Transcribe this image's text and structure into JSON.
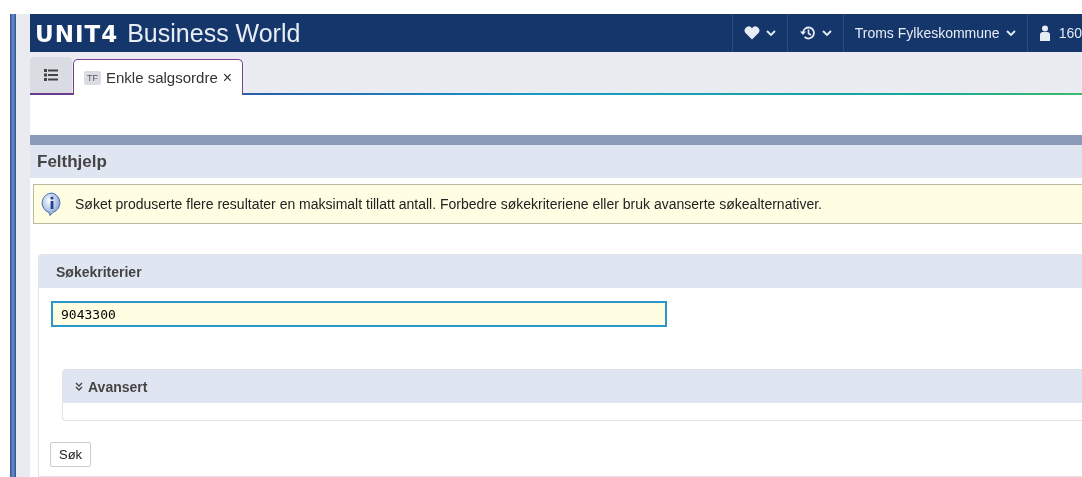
{
  "header": {
    "logo": "UNIT4",
    "product": "Business World",
    "company": "Troms Fylkeskommune",
    "user": "160"
  },
  "tabs": [
    {
      "badge": "TF",
      "label": "Enkle salgsordre",
      "close": "×",
      "selected": true
    }
  ],
  "dialog": {
    "title": "Felthjelp",
    "message": "Søket produserte flere resultater en maksimalt tillatt antall. Forbedre søkekriteriene eller bruk avanserte søkealternativer.",
    "criteria": {
      "title": "Søkekriterier",
      "value": "9043300"
    },
    "advanced": {
      "title": "Avansert",
      "expanded": false
    },
    "search_button": "Søk"
  }
}
